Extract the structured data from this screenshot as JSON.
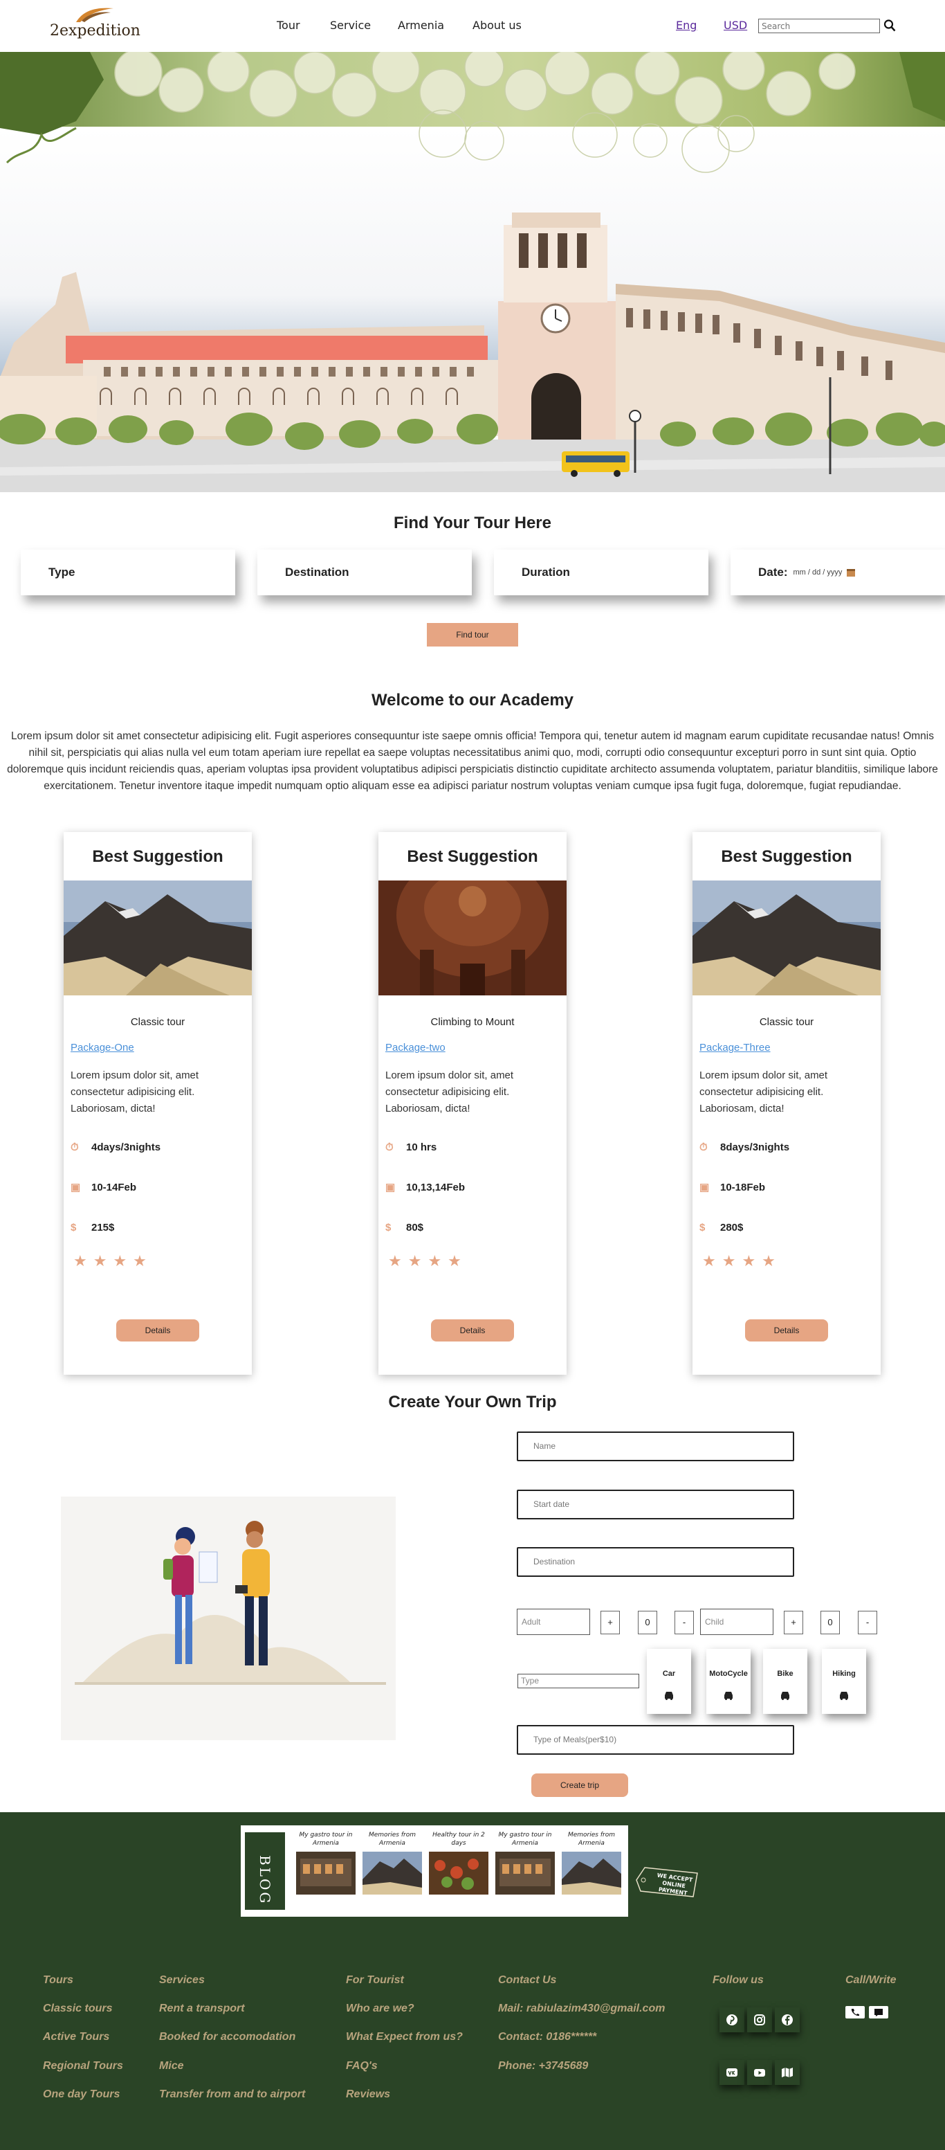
{
  "nav": {
    "logo_text": "2expedition",
    "menu": [
      "Tour",
      "Service",
      "Armenia",
      "About us"
    ],
    "lang": "Eng",
    "currency": "USD",
    "search_placeholder": "Search"
  },
  "find": {
    "title": "Find Your Tour Here",
    "filters": [
      "Type",
      "Destination",
      "Duration"
    ],
    "date_label": "Date:",
    "date_placeholder": "mm / dd / yyyy",
    "button": "Find tour"
  },
  "welcome": {
    "title": "Welcome to our Academy",
    "text": "Lorem ipsum dolor sit amet consectetur adipisicing elit. Fugit asperiores consequuntur iste saepe omnis officia! Tempora qui, tenetur autem id magnam earum cupiditate recusandae natus! Omnis nihil sit, perspiciatis qui alias nulla vel eum totam aperiam iure repellat ea saepe voluptas necessitatibus animi quo, modi, corrupti odio consequuntur excepturi porro in sunt sint quia. Optio doloremque quis incidunt reiciendis quas, aperiam voluptas ipsa provident voluptatibus adipisci perspiciatis distinctio cupiditate architecto assumenda voluptatem, pariatur blanditiis, similique labore exercitationem. Tenetur inventore itaque impedit numquam optio aliquam esse ea adipisci pariatur nostrum voluptas veniam cumque ipsa fugit fuga, doloremque, fugiat repudiandae."
  },
  "cards": [
    {
      "title": "Best Suggestion",
      "image": "mountain",
      "subtitle": "Classic tour",
      "link": "Package-One",
      "desc": "Lorem ipsum dolor sit, amet consectetur adipisicing elit. Laboriosam, dicta!",
      "duration": "4days/3nights",
      "dates": "10-14Feb",
      "price": "215$",
      "stars": 4,
      "button": "Details"
    },
    {
      "title": "Best Suggestion",
      "image": "church-dome",
      "subtitle": "Climbing to Mount",
      "link": "Package-two",
      "desc": "Lorem ipsum dolor sit, amet consectetur adipisicing elit. Laboriosam, dicta!",
      "duration": "10 hrs",
      "dates": "10,13,14Feb",
      "price": "80$",
      "stars": 4,
      "button": "Details"
    },
    {
      "title": "Best Suggestion",
      "image": "mountain",
      "subtitle": "Classic tour",
      "link": "Package-Three",
      "desc": "Lorem ipsum dolor sit, amet consectetur adipisicing elit. Laboriosam, dicta!",
      "duration": "8days/3nights",
      "dates": "10-18Feb",
      "price": "280$",
      "stars": 4,
      "button": "Details"
    }
  ],
  "create": {
    "title": "Create Your Own Trip",
    "name_placeholder": "Name",
    "start_placeholder": "Start date",
    "destination_placeholder": "Destination",
    "adult_placeholder": "Adult",
    "adult_count": "0",
    "child_placeholder": "Child",
    "child_count": "0",
    "plus": "+",
    "minus": "-",
    "type_placeholder": "Type",
    "transport": [
      "Car",
      "MotoCycle",
      "Bike",
      "Hiking"
    ],
    "meals_placeholder": "Type of Meals(per$10)",
    "button": "Create trip"
  },
  "blog": {
    "label": "BLOG",
    "items": [
      {
        "caption": "My gastro tour in Armenia"
      },
      {
        "caption": "Memories from Armenia"
      },
      {
        "caption": "Healthy tour in 2 days"
      },
      {
        "caption": "My gastro tour in Armenia"
      },
      {
        "caption": "Memories from Armenia"
      }
    ],
    "tag_text": "WE ACCEPT ONLINE PAYMENT"
  },
  "footer": {
    "col_tours": {
      "heading": "Tours",
      "links": [
        "Classic tours",
        "Active Tours",
        "Regional Tours",
        "One day Tours"
      ]
    },
    "col_services": {
      "heading": "Services",
      "links": [
        "Rent a transport",
        "Booked for accomodation",
        "Mice",
        "Transfer from and to airport"
      ]
    },
    "col_tourist": {
      "heading": "For Tourist",
      "links": [
        "Who are we?",
        "What Expect from us?",
        "FAQ's",
        "Reviews"
      ]
    },
    "col_contact": {
      "heading": "Contact Us",
      "lines": [
        "Mail: rabiulazim430@gmail.com",
        "Contact: 0186******",
        "Phone: +3745689"
      ]
    },
    "follow_heading": "Follow us",
    "call_heading": "Call/Write"
  },
  "colors": {
    "accent": "#e6a583",
    "footer_bg": "#2a4426",
    "footer_text": "#b8a47e",
    "link": "#4a90d9"
  }
}
